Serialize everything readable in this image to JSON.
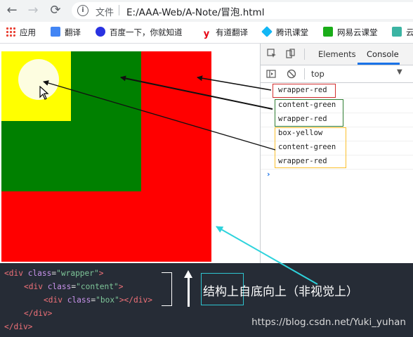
{
  "browser": {
    "back_icon": "←",
    "forward_icon": "→",
    "reload_icon": "⟳",
    "info_icon": "i",
    "scheme_label": "文件",
    "url": "E:/AAA-Web/A-Note/冒泡.html"
  },
  "bookmarks": [
    {
      "label": "应用",
      "icon": "apps-grid-icon",
      "color": "#e94235"
    },
    {
      "label": "翻译",
      "icon": "translate-icon",
      "color": "#4285f4"
    },
    {
      "label": "百度一下，你就知道",
      "icon": "baidu-paw-icon",
      "color": "#2932e1"
    },
    {
      "label": "有道翻译",
      "icon": "youdao-icon",
      "color": "#e60012"
    },
    {
      "label": "腾讯课堂",
      "icon": "tencent-classroom-icon",
      "color": "#12b7f5"
    },
    {
      "label": "网易云课堂",
      "icon": "netease-classroom-icon",
      "color": "#1aad19"
    },
    {
      "label": "云",
      "icon": "cloud-icon",
      "color": "#3bb4a3"
    }
  ],
  "devtools": {
    "tabs": [
      "Elements",
      "Console"
    ],
    "active_tab": "Console",
    "context": "top",
    "prompt": "›",
    "groups": [
      {
        "color": "#d32f2f",
        "lines": [
          "wrapper-red"
        ]
      },
      {
        "color": "#2e7d32",
        "lines": [
          "content-green",
          "wrapper-red"
        ]
      },
      {
        "color": "#fbc02d",
        "lines": [
          "box-yellow",
          "content-green",
          "wrapper-red"
        ]
      }
    ]
  },
  "code": {
    "line1": {
      "open": "<div ",
      "attr": "class",
      "eq": "=",
      "val": "\"wrapper\"",
      "close": ">"
    },
    "line2": {
      "open": "<div ",
      "attr": "class",
      "eq": "=",
      "val": "\"content\"",
      "close": ">"
    },
    "line3": {
      "open": "<div ",
      "attr": "class",
      "eq": "=",
      "val": "\"box\"",
      "close": "></div>"
    },
    "line4": "</div>",
    "line5": "</div>",
    "note": "结构上自底向上（非视觉上）",
    "watermark": "https://blog.csdn.net/Yuki_yuhan"
  },
  "colors": {
    "wrapper": "#ff0000",
    "content": "#008000",
    "box": "#ffff00",
    "annotation_arrow": "#111111",
    "cyan_arrow": "#2ed3dc"
  }
}
